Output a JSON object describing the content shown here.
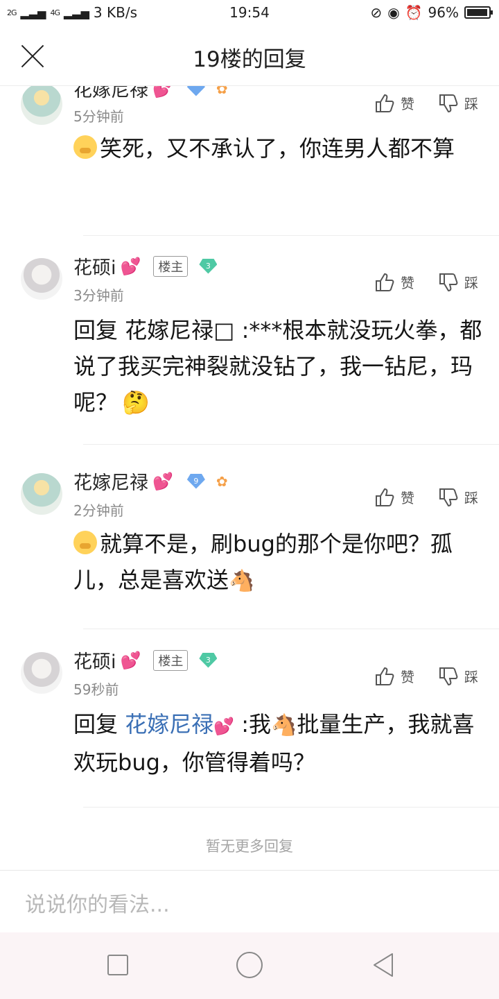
{
  "status_bar": {
    "signal_left": "2G",
    "signal_right": "4G",
    "net_speed": "3 KB/s",
    "time": "19:54",
    "battery": "96%",
    "battery_level": 0.96
  },
  "header": {
    "title": "19楼的回复"
  },
  "replies": [
    {
      "username": "花嫁尼禄",
      "time": "5分钟前",
      "content": "笑死，又不承认了，你连男人都不算",
      "like_label": "赞",
      "dislike_label": "踩"
    },
    {
      "username": "花硕i",
      "owner_badge": "楼主",
      "level": "3",
      "time": "3分钟前",
      "content": "回复 花嫁尼禄□ :***根本就没玩火拳，都说了我买完神裂就没钻了，我一钻尼，玛呢？",
      "like_label": "赞",
      "dislike_label": "踩"
    },
    {
      "username": "花嫁尼禄",
      "level": "9",
      "time": "2分钟前",
      "content": "就算不是，刷bug的那个是你吧？孤儿，总是喜欢送",
      "like_label": "赞",
      "dislike_label": "踩"
    },
    {
      "username": "花硕i",
      "owner_badge": "楼主",
      "level": "3",
      "time": "59秒前",
      "content_prefix": "回复 ",
      "content_link": "花嫁尼禄",
      "content_mid": " :我",
      "content_rest": "批量生产，我就喜欢玩bug，你管得着吗？",
      "like_label": "赞",
      "dislike_label": "踩"
    }
  ],
  "footer": {
    "no_more_text": "暂无更多回复",
    "input_placeholder": "说说你的看法..."
  },
  "icons": {
    "close": "close-icon",
    "like": "thumbs-up-icon",
    "dislike": "thumbs-down-icon",
    "heart": "heart-emoji-icon",
    "level_gem": "level-gem-icon",
    "lung": "lung-badge-icon",
    "cover_mouth": "cover-mouth-emoji-icon",
    "thinking": "thinking-emoji-icon",
    "horse": "horse-emoji-icon"
  },
  "colors": {
    "link": "#3a6fb5",
    "heart": "#f06aa0",
    "gem_green": "#4fc9a4",
    "gem_blue": "#6ea8ef",
    "nav_bar": "#fbf4f6"
  }
}
